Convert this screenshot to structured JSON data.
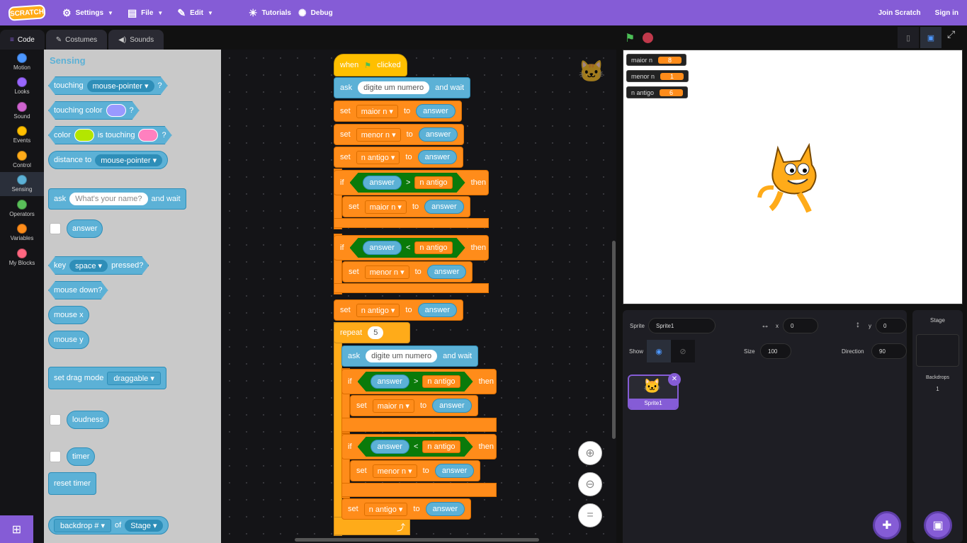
{
  "menubar": {
    "logo": "SCRATCH",
    "settings": "Settings",
    "file": "File",
    "edit": "Edit",
    "tutorials": "Tutorials",
    "debug": "Debug",
    "join": "Join Scratch",
    "signin": "Sign in"
  },
  "tabs": {
    "code": "Code",
    "costumes": "Costumes",
    "sounds": "Sounds"
  },
  "categories": [
    {
      "label": "Motion",
      "color": "#4c97ff"
    },
    {
      "label": "Looks",
      "color": "#9966ff"
    },
    {
      "label": "Sound",
      "color": "#cf63cf"
    },
    {
      "label": "Events",
      "color": "#ffbf00"
    },
    {
      "label": "Control",
      "color": "#ffab19"
    },
    {
      "label": "Sensing",
      "color": "#5cb1d6"
    },
    {
      "label": "Operators",
      "color": "#59c059"
    },
    {
      "label": "Variables",
      "color": "#ff8c1a"
    },
    {
      "label": "My Blocks",
      "color": "#ff6680"
    }
  ],
  "palette": {
    "title": "Sensing",
    "touching": "touching",
    "mouse_pointer": "mouse-pointer",
    "q": "?",
    "touching_color": "touching color",
    "color": "color",
    "is_touching": "is touching",
    "distance_to": "distance to",
    "ask": "ask",
    "ask_placeholder": "What's your name?",
    "and_wait": "and wait",
    "answer": "answer",
    "key": "key",
    "space": "space",
    "pressed": "pressed?",
    "mouse_down": "mouse down?",
    "mouse_x": "mouse x",
    "mouse_y": "mouse y",
    "set_drag_mode": "set drag mode",
    "draggable": "draggable",
    "loudness": "loudness",
    "timer": "timer",
    "reset_timer": "reset timer",
    "backdrop": "backdrop #",
    "of": "of",
    "stage": "Stage"
  },
  "script": {
    "when": "when",
    "clicked": "clicked",
    "ask": "ask",
    "ask_prompt": "digite um numero",
    "and_wait": "and wait",
    "set": "set",
    "to": "to",
    "answer": "answer",
    "maior_n": "maior n",
    "menor_n": "menor n",
    "n_antigo": "n antigo",
    "if": "if",
    "then": "then",
    "gt": ">",
    "lt": "<",
    "repeat": "repeat",
    "repeat_count": "5",
    "loop_arrow": "⤴"
  },
  "monitors": [
    {
      "name": "maior n",
      "value": "8"
    },
    {
      "name": "menor n",
      "value": "1"
    },
    {
      "name": "n antigo",
      "value": "6"
    }
  ],
  "sprite_info": {
    "sprite_label": "Sprite",
    "sprite_name": "Sprite1",
    "x_label": "x",
    "x": "0",
    "y_label": "y",
    "y": "0",
    "show_label": "Show",
    "size_label": "Size",
    "size": "100",
    "direction_label": "Direction",
    "direction": "90"
  },
  "sprites": [
    {
      "name": "Sprite1"
    }
  ],
  "stage_panel": {
    "title": "Stage",
    "backdrops_label": "Backdrops",
    "backdrops_count": "1"
  }
}
